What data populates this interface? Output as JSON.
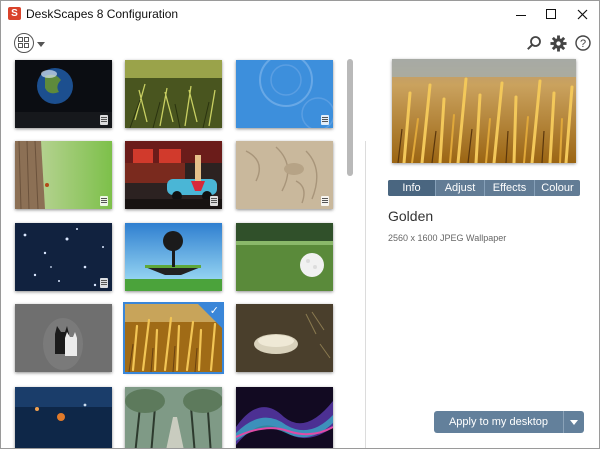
{
  "window": {
    "title": "DeskScapes 8 Configuration",
    "app_icon_letter": "S"
  },
  "toolbar": {
    "view_icon": "view-mode-icon",
    "search_icon": "search-icon",
    "settings_icon": "gear-icon",
    "help_icon": "help-icon",
    "help_glyph": "?"
  },
  "thumbnails": [
    {
      "subject": "earth",
      "badge": true
    },
    {
      "subject": "pine-plants",
      "badge": false
    },
    {
      "subject": "blue-abstract",
      "badge": true
    },
    {
      "subject": "tree-bark",
      "badge": true
    },
    {
      "subject": "diner-car",
      "badge": true
    },
    {
      "subject": "sand",
      "badge": true
    },
    {
      "subject": "stars",
      "badge": true
    },
    {
      "subject": "floating-island",
      "badge": false
    },
    {
      "subject": "golf-ball",
      "badge": false
    },
    {
      "subject": "ceramic-cats",
      "badge": false
    },
    {
      "subject": "golden-wheat",
      "badge": false,
      "selected": true
    },
    {
      "subject": "stone",
      "badge": false
    },
    {
      "subject": "planets",
      "badge": false
    },
    {
      "subject": "tree-alley",
      "badge": false
    },
    {
      "subject": "aurora",
      "badge": false
    }
  ],
  "detail": {
    "tabs": [
      {
        "label": "Info",
        "active": true
      },
      {
        "label": "Adjust"
      },
      {
        "label": "Effects"
      },
      {
        "label": "Colour"
      }
    ],
    "title": "Golden",
    "subtitle": "2560 x 1600 JPEG Wallpaper",
    "apply_label": "Apply to my desktop"
  },
  "colors": {
    "accent": "#3a86d8",
    "button": "#63809b",
    "tabs": "#627c95"
  }
}
